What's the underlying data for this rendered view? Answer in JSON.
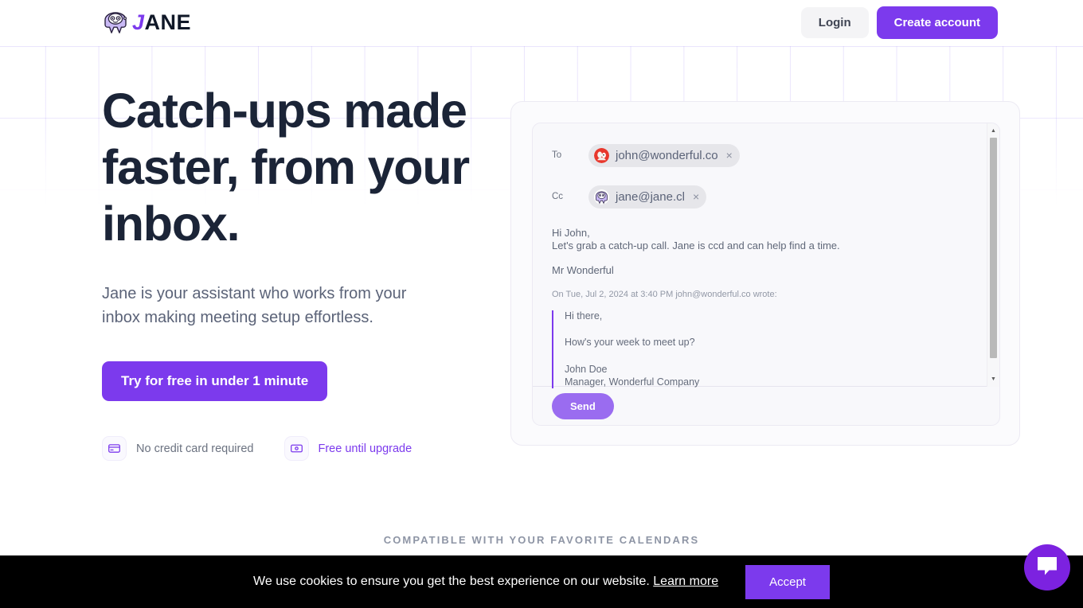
{
  "header": {
    "logo_text_accent": "J",
    "logo_text_rest": "ANE",
    "logo_icon": "robot-head-icon",
    "login_label": "Login",
    "create_account_label": "Create account"
  },
  "hero": {
    "title": "Catch-ups made faster, from your inbox.",
    "subtitle": "Jane is your assistant who works from your inbox making meeting setup effortless.",
    "cta_label": "Try for free in under 1 minute",
    "badges": [
      {
        "icon": "credit-card-icon",
        "label": "No credit card required",
        "accent": false
      },
      {
        "icon": "banknote-icon",
        "label": "Free until upgrade",
        "accent": true
      }
    ]
  },
  "mail": {
    "to_label": "To",
    "to_chip": "john@wonderful.co",
    "to_chip_remove": "×",
    "cc_label": "Cc",
    "cc_chip": "jane@jane.cl",
    "cc_chip_remove": "×",
    "body": {
      "greeting": "Hi John,",
      "line1": "Let's grab a catch-up call. Jane is ccd and can help find a time.",
      "signature": "Mr Wonderful",
      "quote_header": "On Tue, Jul 2, 2024 at 3:40 PM john@wonderful.co wrote:",
      "quote_line1": "Hi there,",
      "quote_line2": "How's your week to meet up?",
      "quote_name": "John Doe",
      "quote_title": "Manager, Wonderful Company"
    },
    "send_label": "Send",
    "scroll_up_icon": "▲",
    "scroll_down_icon": "▼"
  },
  "compatible_text": "COMPATIBLE WITH YOUR FAVORITE CALENDARS",
  "cookie": {
    "message": "We use cookies to ensure you get the best experience on our website.",
    "link_label": "Learn more",
    "accept_label": "Accept"
  },
  "chat": {
    "icon": "chat-bubble-icon"
  },
  "colors": {
    "accent_purple": "#7c3aed",
    "send_purple": "#9a6cf0",
    "heading_navy": "#1b2437",
    "cookie_bg": "#000000"
  }
}
